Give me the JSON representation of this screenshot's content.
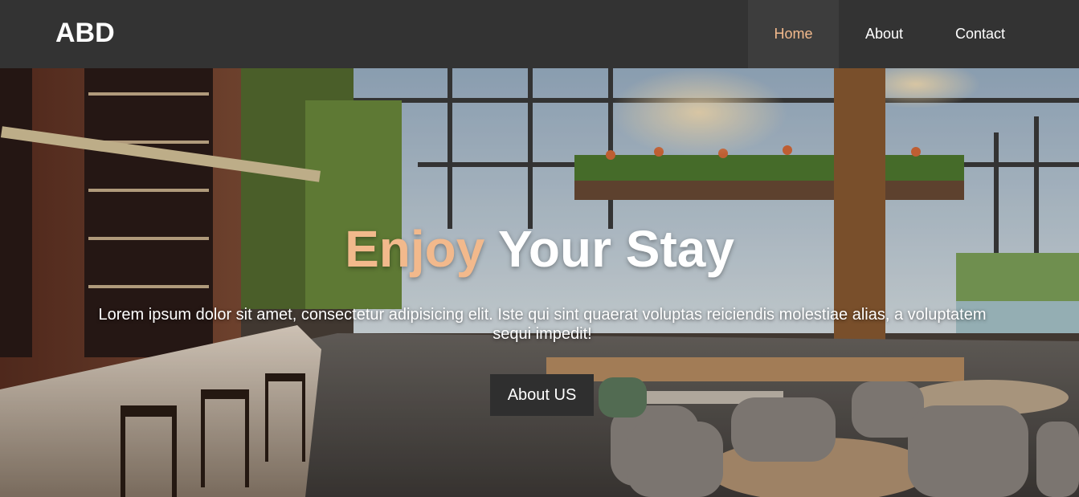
{
  "navbar": {
    "logo": "ABD",
    "links": [
      {
        "label": "Home",
        "active": true
      },
      {
        "label": "About",
        "active": false
      },
      {
        "label": "Contact",
        "active": false
      }
    ]
  },
  "hero": {
    "title_accent": "Enjoy",
    "title_rest": " Your Stay",
    "subtitle": "Lorem ipsum dolor sit amet, consectetur adipisicing elit. Iste qui sint quaerat voluptas reiciendis molestiae alias, a voluptatem sequi impedit!",
    "button_label": "About US",
    "background_scene": "restaurant-interior-photo"
  },
  "colors": {
    "navbar_bg": "#333333",
    "nav_active_bg": "#3d3d3d",
    "accent": "#f2b98c",
    "button_bg": "#2f2f2f",
    "text": "#ffffff"
  }
}
